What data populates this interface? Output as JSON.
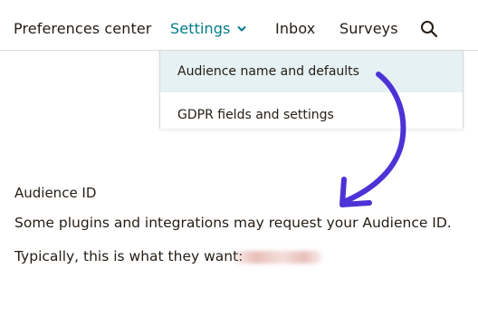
{
  "nav": {
    "items": [
      {
        "label": "Preferences center"
      },
      {
        "label": "Settings",
        "active": true
      },
      {
        "label": "Inbox"
      },
      {
        "label": "Surveys"
      }
    ],
    "search_icon": "search-icon",
    "active_color": "#007c89"
  },
  "dropdown": {
    "items": [
      {
        "label": "Audience name and defaults",
        "highlighted": true
      },
      {
        "label": "GDPR fields and settings"
      }
    ],
    "highlight_color": "#e5f1f3"
  },
  "content": {
    "heading": "Audience ID",
    "line1": "Some plugins and integrations may request your Audience ID.",
    "line2": "Typically, this is what they want:"
  },
  "annotation": {
    "arrow_color": "#4b33d6"
  }
}
